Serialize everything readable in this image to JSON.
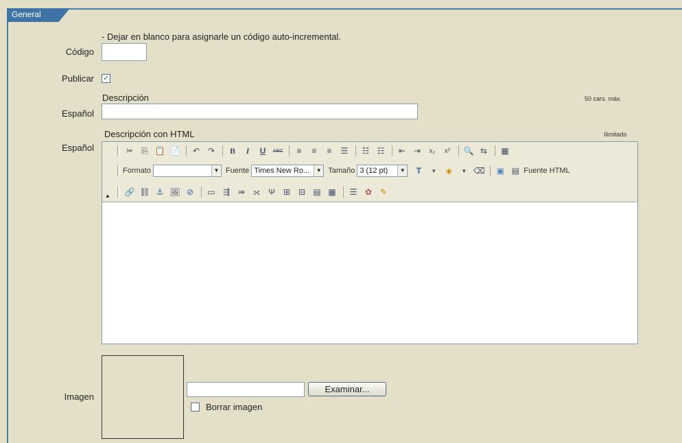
{
  "tab": {
    "label": "General"
  },
  "codigo": {
    "hint": "- Dejar en blanco para asignarle un código auto-incremental.",
    "label": "Código",
    "value": ""
  },
  "publicar": {
    "label": "Publicar",
    "checked_glyph": "✓"
  },
  "descripcion": {
    "heading": "Descripción",
    "limit": "50 cars. máx.",
    "label": "Español",
    "value": ""
  },
  "descripcion_html": {
    "heading": "Descripción con HTML",
    "limit": "Ilimitado",
    "label": "Español",
    "toolbar": {
      "formato_label": "Formato",
      "formato_value": "",
      "fuente_label": "Fuente",
      "fuente_value": "Times New Ro...",
      "tamano_label": "Tamaño",
      "tamano_value": "3 (12 pt)",
      "source_label": "Fuente HTML",
      "bold": "B",
      "italic": "I",
      "underline": "U",
      "abc": "ABC",
      "subscript": "x₂",
      "superscript": "x²"
    }
  },
  "imagen": {
    "label": "Imagen",
    "browse_label": "Examinar...",
    "delete_label": "Borrar imagen",
    "value": ""
  }
}
